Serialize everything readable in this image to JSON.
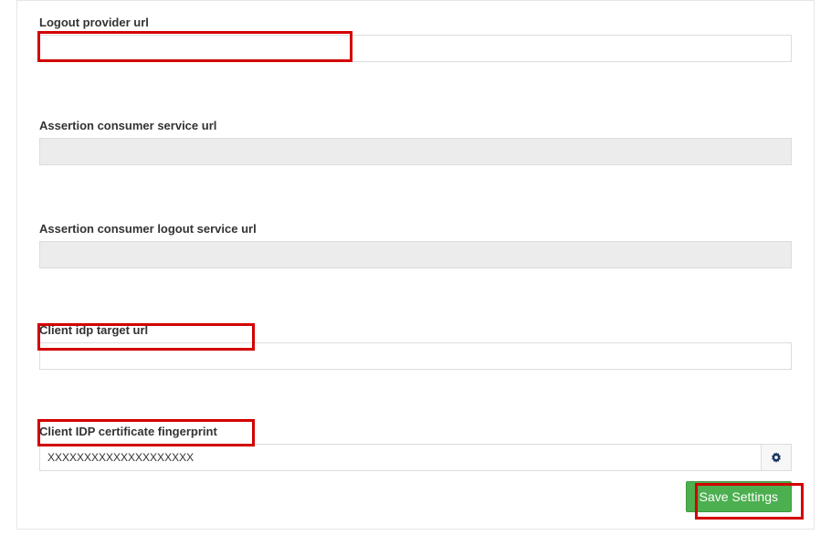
{
  "fields": {
    "logout_provider": {
      "label": "Logout provider url",
      "value": ""
    },
    "acs_url": {
      "label": "Assertion consumer service url",
      "value": ""
    },
    "acs_logout_url": {
      "label": "Assertion consumer logout service url",
      "value": ""
    },
    "client_idp_target": {
      "label": "Client idp target url",
      "value": ""
    },
    "client_idp_fingerprint": {
      "label": "Client IDP certificate fingerprint",
      "value": "XXXXXXXXXXXXXXXXXXXX"
    }
  },
  "buttons": {
    "save": "Save Settings"
  }
}
